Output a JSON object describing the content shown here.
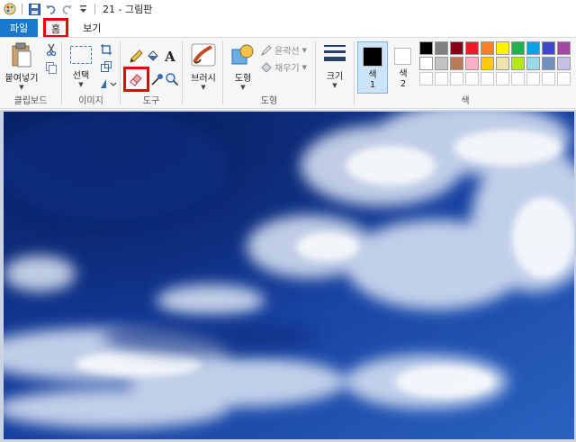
{
  "titlebar": {
    "title": "21 - 그림판"
  },
  "tabs": {
    "file": "파일",
    "home": "홈",
    "view": "보기"
  },
  "clipboard": {
    "paste": "붙여넣기",
    "group": "클립보드"
  },
  "image": {
    "select": "선택",
    "group": "이미지"
  },
  "tools": {
    "group": "도구",
    "text_tool": "A"
  },
  "brushes": {
    "label": "브러시"
  },
  "shapes": {
    "shapes": "도형",
    "outline": "윤곽선",
    "fill": "채우기",
    "group": "도형"
  },
  "size": {
    "label": "크기"
  },
  "colors": {
    "color1": "색\n1",
    "color1_a": "색",
    "color1_b": "1",
    "color2_a": "색",
    "color2_b": "2",
    "group": "색",
    "color1_value": "#000000",
    "color2_value": "#ffffff",
    "palette_row1": [
      "#000000",
      "#7f7f7f",
      "#880015",
      "#ed1c24",
      "#ff7f27",
      "#fff200",
      "#22b14c",
      "#00a2e8",
      "#3f48cc",
      "#a349a4"
    ],
    "palette_row2": [
      "#ffffff",
      "#c3c3c3",
      "#b97a57",
      "#ffaec9",
      "#ffc90e",
      "#efe4b0",
      "#b5e61d",
      "#99d9ea",
      "#7092be",
      "#c8bfe7"
    ]
  },
  "accent": {
    "file_tab": "#1979ca",
    "highlight": "#e8000b"
  }
}
